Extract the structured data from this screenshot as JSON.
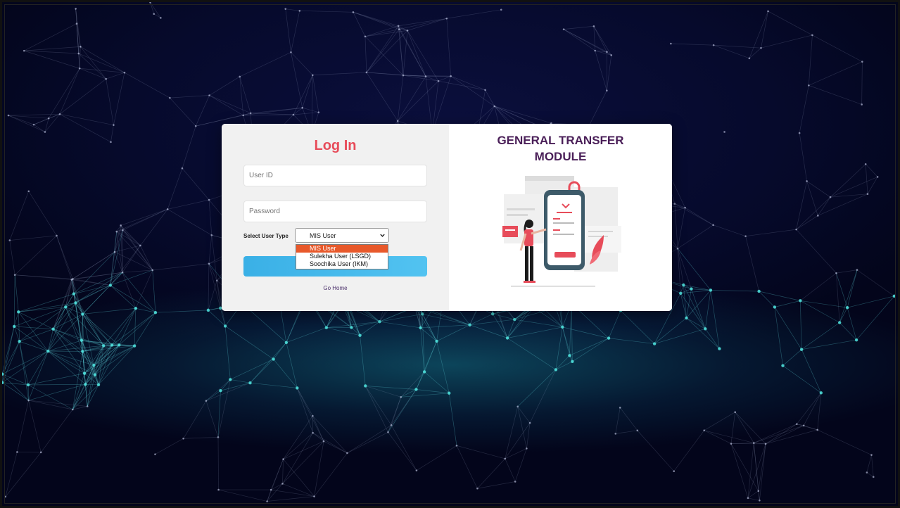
{
  "login": {
    "title": "Log In",
    "userid_placeholder": "User ID",
    "password_placeholder": "Password",
    "usertype_label": "Select User Type",
    "usertype_selected": "MIS User",
    "usertype_options": [
      "MIS User",
      "Sulekha User (LSGD)",
      "Soochika User (IKM)"
    ],
    "go_home": "Go Home"
  },
  "module": {
    "title_line1": "GENERAL TRANSFER",
    "title_line2": "MODULE"
  },
  "colors": {
    "title_red": "#e74c5a",
    "module_purple": "#4a1f58",
    "button_blue": "#3ab0e6",
    "dropdown_highlight": "#e8592b",
    "background_navy": "#060a2c"
  }
}
